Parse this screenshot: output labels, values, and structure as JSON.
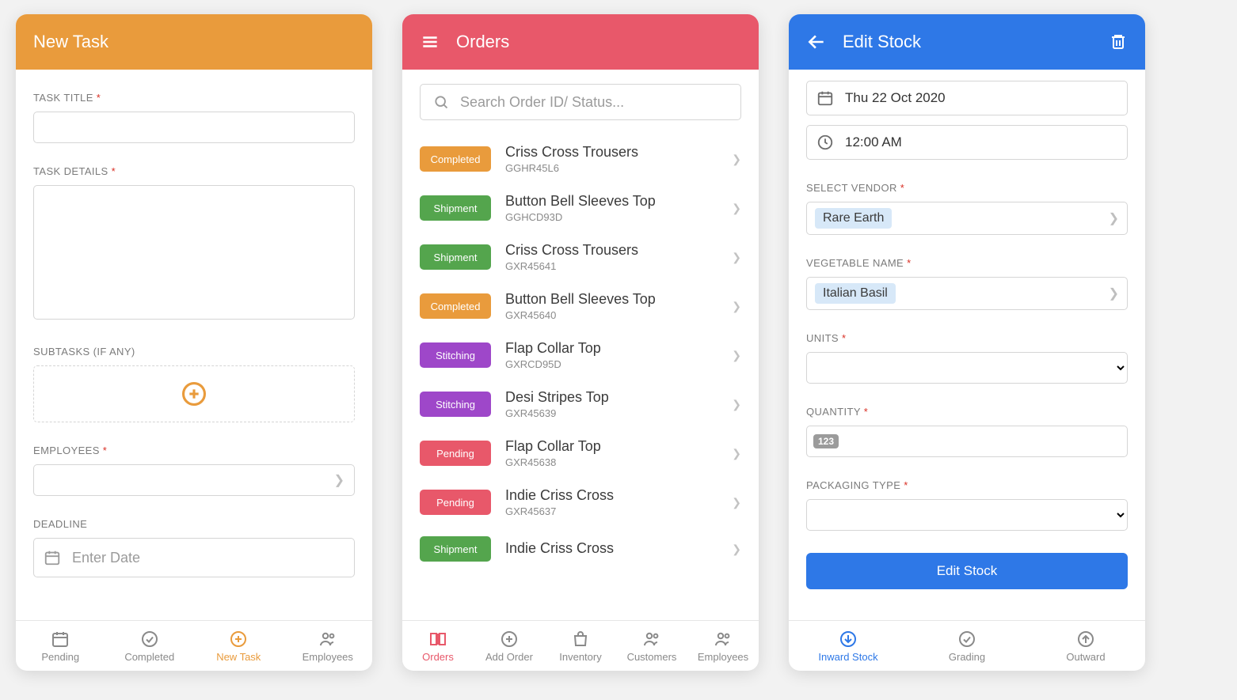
{
  "screen1": {
    "title": "New Task",
    "labels": {
      "task_title": "TASK TITLE",
      "task_details": "TASK DETAILS",
      "subtasks": "SUBTASKS (IF ANY)",
      "employees": "EMPLOYEES",
      "deadline": "DEADLINE"
    },
    "placeholders": {
      "deadline": "Enter Date"
    },
    "tabs": [
      "Pending",
      "Completed",
      "New Task",
      "Employees"
    ]
  },
  "screen2": {
    "title": "Orders",
    "search_placeholder": "Search Order ID/ Status...",
    "orders": [
      {
        "status": "Completed",
        "status_key": "completed",
        "name": "Criss Cross Trousers",
        "id": "GGHR45L6"
      },
      {
        "status": "Shipment",
        "status_key": "shipment",
        "name": "Button Bell Sleeves Top",
        "id": "GGHCD93D"
      },
      {
        "status": "Shipment",
        "status_key": "shipment",
        "name": "Criss Cross Trousers",
        "id": "GXR45641"
      },
      {
        "status": "Completed",
        "status_key": "completed",
        "name": "Button Bell Sleeves Top",
        "id": "GXR45640"
      },
      {
        "status": "Stitching",
        "status_key": "stitching",
        "name": "Flap Collar Top",
        "id": "GXRCD95D"
      },
      {
        "status": "Stitching",
        "status_key": "stitching",
        "name": "Desi Stripes Top",
        "id": "GXR45639"
      },
      {
        "status": "Pending",
        "status_key": "pending",
        "name": "Flap Collar Top",
        "id": "GXR45638"
      },
      {
        "status": "Pending",
        "status_key": "pending",
        "name": "Indie Criss Cross",
        "id": "GXR45637"
      },
      {
        "status": "Shipment",
        "status_key": "shipment",
        "name": "Indie Criss Cross",
        "id": ""
      }
    ],
    "tabs": [
      "Orders",
      "Add Order",
      "Inventory",
      "Customers",
      "Employees"
    ]
  },
  "screen3": {
    "title": "Edit Stock",
    "date": "Thu 22 Oct 2020",
    "time": "12:00 AM",
    "labels": {
      "vendor": "SELECT VENDOR",
      "veg": "VEGETABLE NAME",
      "units": "UNITS",
      "qty": "QUANTITY",
      "pack": "PACKAGING TYPE"
    },
    "vendor": "Rare Earth",
    "veg": "Italian Basil",
    "qty_icon": "123",
    "button": "Edit Stock",
    "tabs": [
      "Inward Stock",
      "Grading",
      "Outward"
    ]
  }
}
